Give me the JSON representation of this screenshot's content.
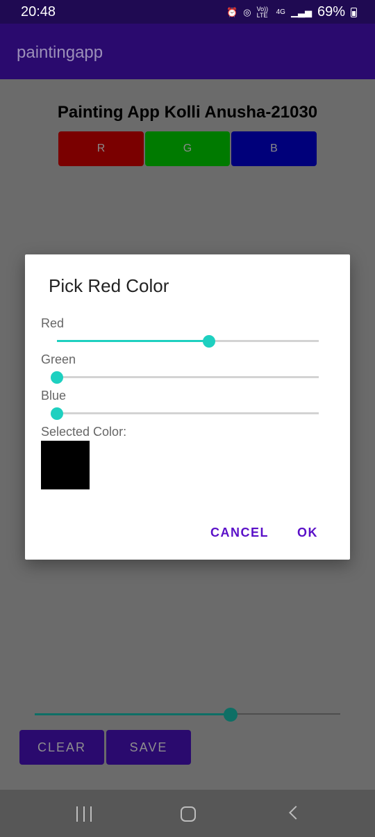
{
  "status_bar": {
    "time": "20:48",
    "network_volte": "Vo)) LTE",
    "network_4g": "4G",
    "battery": "69%"
  },
  "app_bar": {
    "title": "paintingapp"
  },
  "main": {
    "heading": "Painting App Kolli Anusha-21030",
    "color_buttons": [
      {
        "label": "R",
        "color": "#7a0000"
      },
      {
        "label": "G",
        "color": "#007a00"
      },
      {
        "label": "B",
        "color": "#00007a"
      }
    ],
    "brush_slider": {
      "value": 0.64,
      "color": "#0e6f65"
    },
    "actions": {
      "clear_label": "CLEAR",
      "save_label": "SAVE"
    }
  },
  "dialog": {
    "title": "Pick Red Color",
    "sliders": [
      {
        "label": "Red",
        "value": 0.58
      },
      {
        "label": "Green",
        "value": 0.0
      },
      {
        "label": "Blue",
        "value": 0.0
      }
    ],
    "selected_color_label": "Selected Color:",
    "selected_color": "#000000",
    "cancel_label": "CANCEL",
    "ok_label": "OK",
    "accent_color": "#1ed0c0"
  },
  "nav_bar": {
    "icons": [
      "recent-apps-icon",
      "home-icon",
      "back-icon"
    ]
  }
}
